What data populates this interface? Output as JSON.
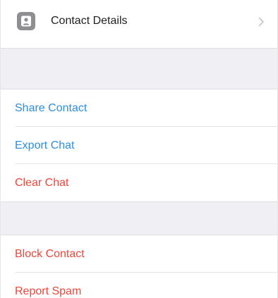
{
  "contact_details": {
    "label": "Contact Details",
    "icon": "contact-card-icon",
    "chevron_icon": "chevron-right-icon"
  },
  "actions_group_1": [
    {
      "label": "Share Contact",
      "color": "#2d8ee3"
    },
    {
      "label": "Export Chat",
      "color": "#2d8ee3"
    },
    {
      "label": "Clear Chat",
      "color": "#f0453a"
    }
  ],
  "actions_group_2": [
    {
      "label": "Block Contact",
      "color": "#f0453a"
    },
    {
      "label": "Report Spam",
      "color": "#f0453a"
    }
  ]
}
